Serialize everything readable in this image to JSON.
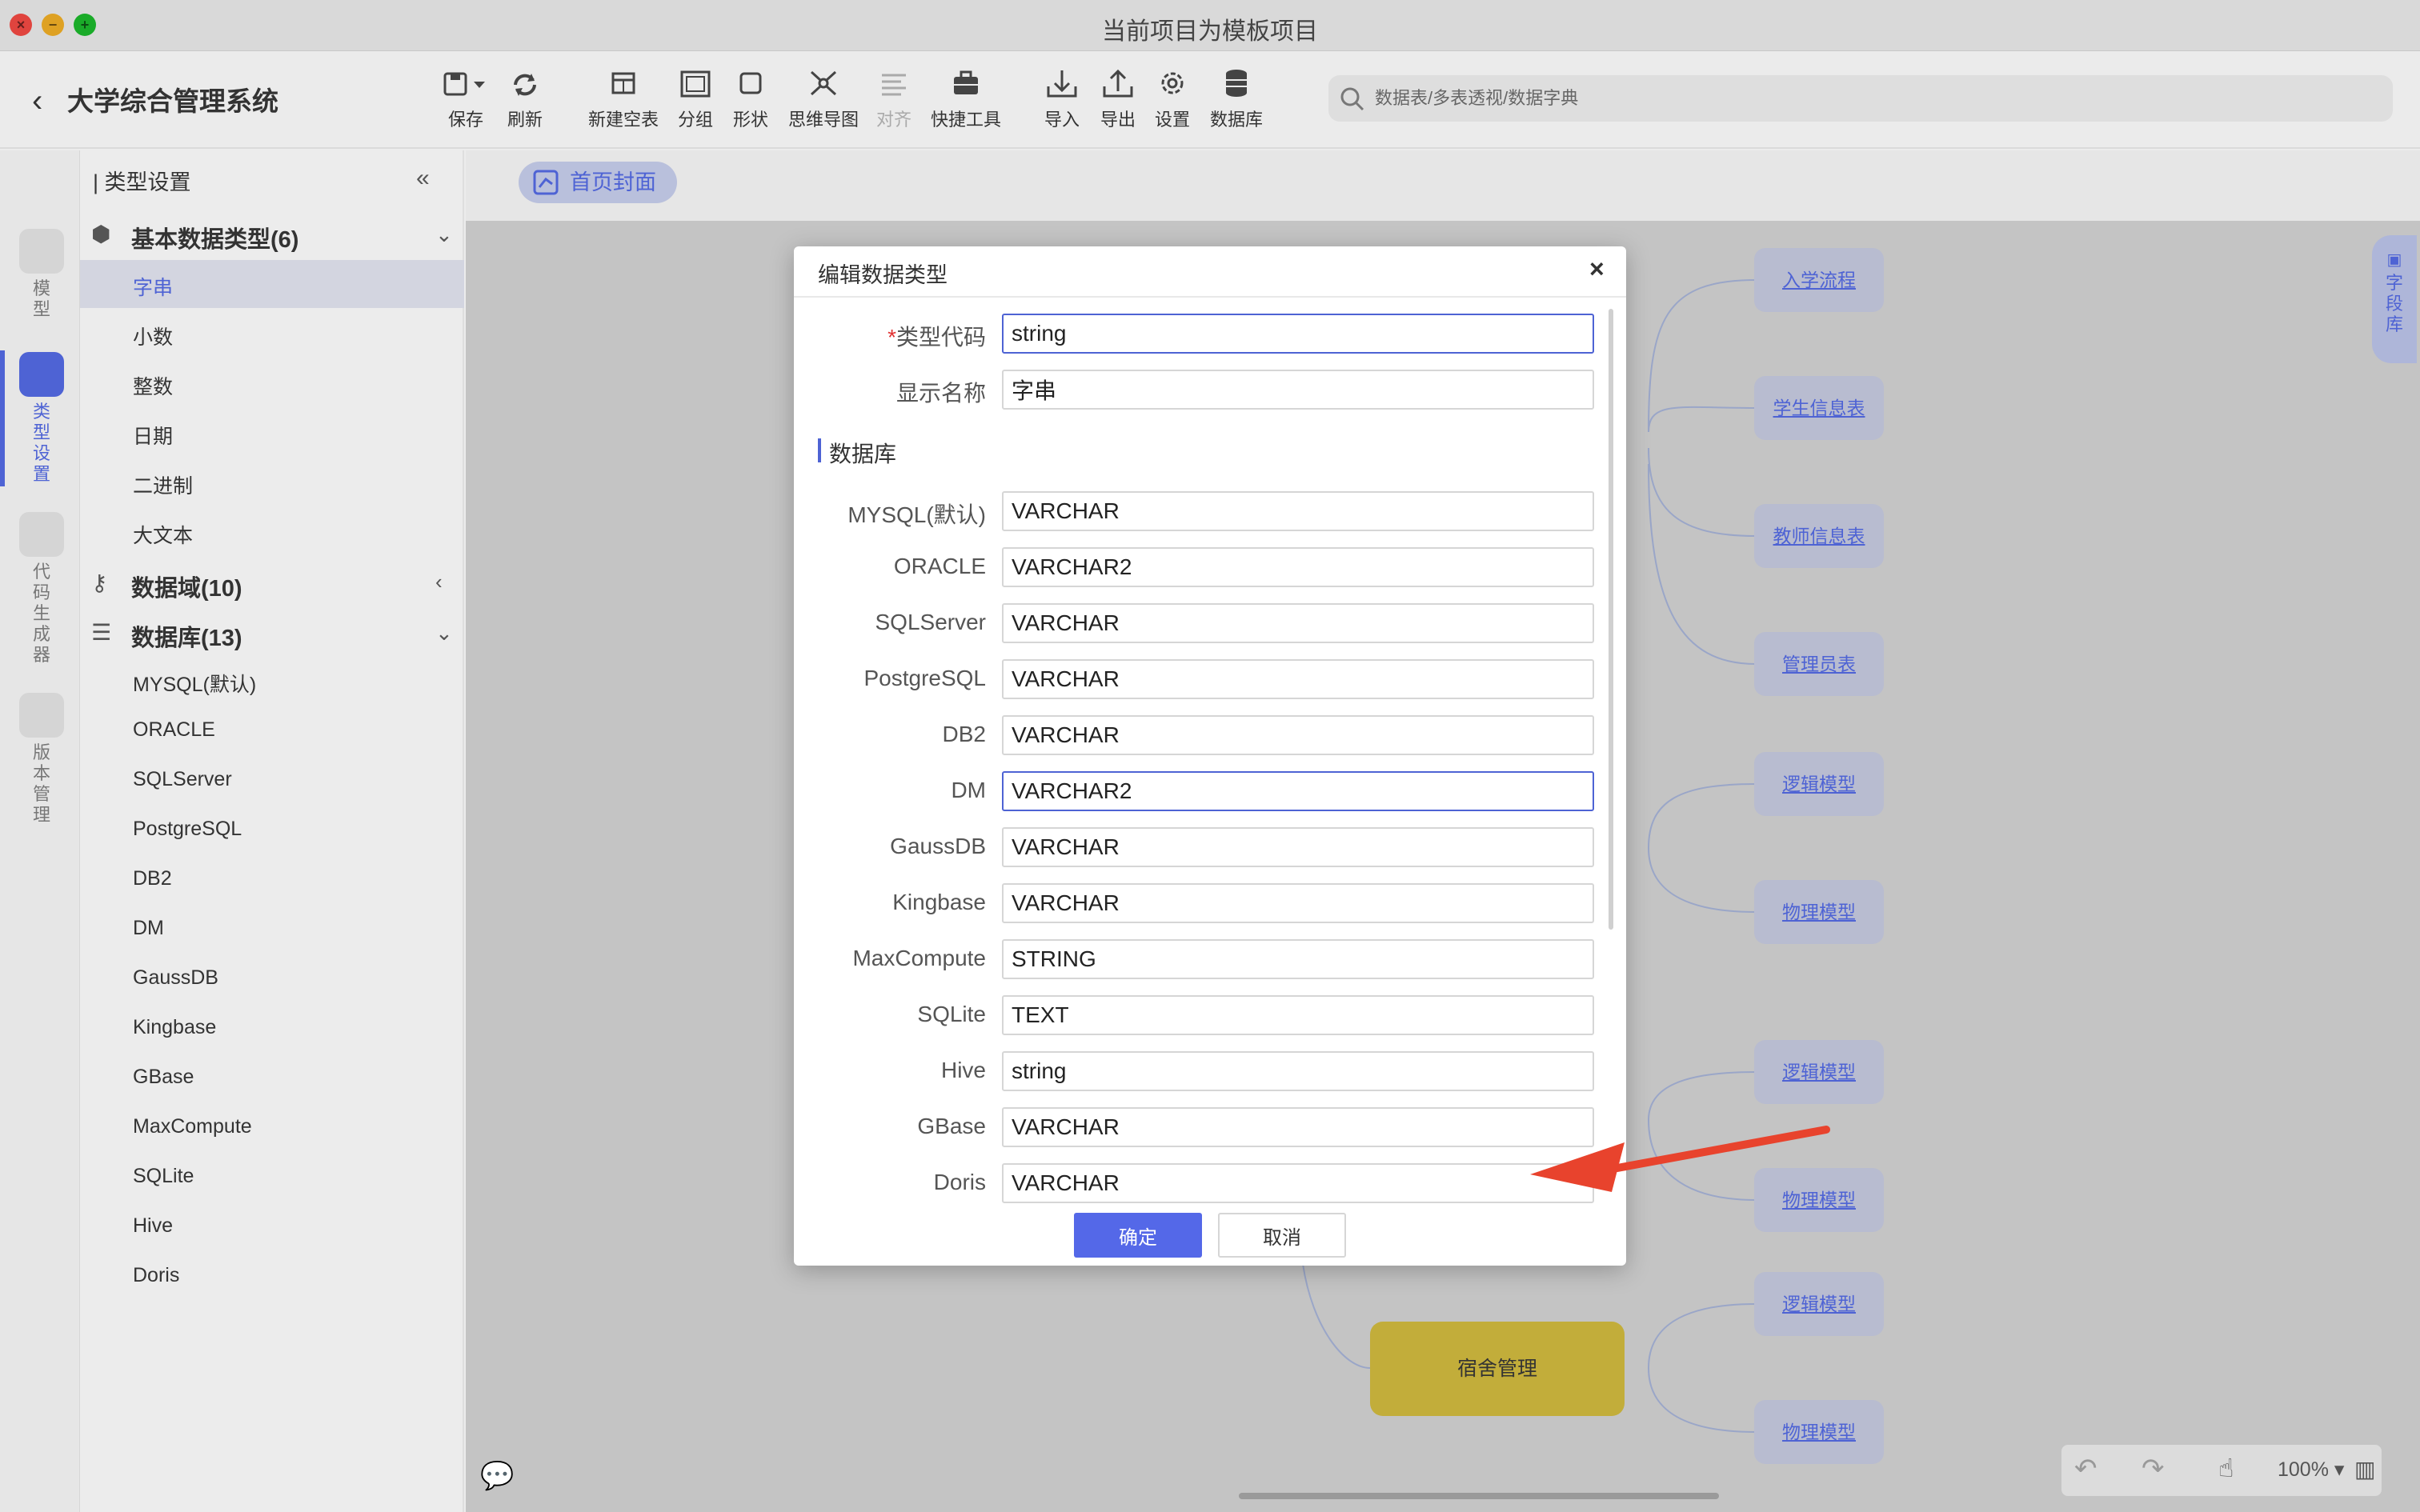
{
  "window": {
    "title": "当前项目为模板项目"
  },
  "header": {
    "app_title": "大学综合管理系统",
    "search_placeholder": "数据表/多表透视/数据字典",
    "tools": [
      {
        "label": "保存",
        "icon": "save-icon"
      },
      {
        "label": "刷新",
        "icon": "refresh-icon"
      },
      {
        "label": "新建空表",
        "icon": "new-table-icon"
      },
      {
        "label": "分组",
        "icon": "group-icon"
      },
      {
        "label": "形状",
        "icon": "shape-icon"
      },
      {
        "label": "思维导图",
        "icon": "mindmap-icon"
      },
      {
        "label": "对齐",
        "icon": "align-icon"
      },
      {
        "label": "快捷工具",
        "icon": "toolbox-icon"
      },
      {
        "label": "导入",
        "icon": "import-icon"
      },
      {
        "label": "导出",
        "icon": "export-icon"
      },
      {
        "label": "设置",
        "icon": "gear-icon"
      },
      {
        "label": "数据库",
        "icon": "database-icon"
      }
    ]
  },
  "rail": {
    "items": [
      {
        "label": "模型"
      },
      {
        "label": "类型设置"
      },
      {
        "label": "代码生成器"
      },
      {
        "label": "版本管理"
      }
    ]
  },
  "sidebar": {
    "heading": "类型设置",
    "groups": [
      {
        "label": "基本数据类型(6)",
        "items": [
          "字串",
          "小数",
          "整数",
          "日期",
          "二进制",
          "大文本"
        ]
      },
      {
        "label": "数据域(10)"
      },
      {
        "label": "数据库(13)",
        "items": [
          "MYSQL(默认)",
          "ORACLE",
          "SQLServer",
          "PostgreSQL",
          "DB2",
          "DM",
          "GaussDB",
          "Kingbase",
          "GBase",
          "MaxCompute",
          "SQLite",
          "Hive",
          "Doris"
        ]
      }
    ]
  },
  "canvas": {
    "tab": "首页封面",
    "nodes": [
      "入学流程",
      "学生信息表",
      "教师信息表",
      "管理员表",
      "逻辑模型",
      "物理模型",
      "逻辑模型",
      "物理模型",
      "逻辑模型",
      "物理模型"
    ],
    "dorm_node": "宿舍管理",
    "field_lib": "字段库",
    "zoom": "100%"
  },
  "dialog": {
    "title": "编辑数据类型",
    "type_code_label": "类型代码",
    "type_code": "string",
    "display_name_label": "显示名称",
    "display_name": "字串",
    "section": "数据库",
    "rows": [
      {
        "db": "MYSQL(默认)",
        "value": "VARCHAR"
      },
      {
        "db": "ORACLE",
        "value": "VARCHAR2"
      },
      {
        "db": "SQLServer",
        "value": "VARCHAR"
      },
      {
        "db": "PostgreSQL",
        "value": "VARCHAR"
      },
      {
        "db": "DB2",
        "value": "VARCHAR"
      },
      {
        "db": "DM",
        "value": "VARCHAR2"
      },
      {
        "db": "GaussDB",
        "value": "VARCHAR"
      },
      {
        "db": "Kingbase",
        "value": "VARCHAR"
      },
      {
        "db": "MaxCompute",
        "value": "STRING"
      },
      {
        "db": "SQLite",
        "value": "TEXT"
      },
      {
        "db": "Hive",
        "value": "string"
      },
      {
        "db": "GBase",
        "value": "VARCHAR"
      },
      {
        "db": "Doris",
        "value": "VARCHAR"
      }
    ],
    "ok_label": "确定",
    "cancel_label": "取消"
  },
  "colors": {
    "accent": "#4e63d4",
    "button_primary": "#5468e8",
    "annotation_arrow": "#e8432d"
  }
}
